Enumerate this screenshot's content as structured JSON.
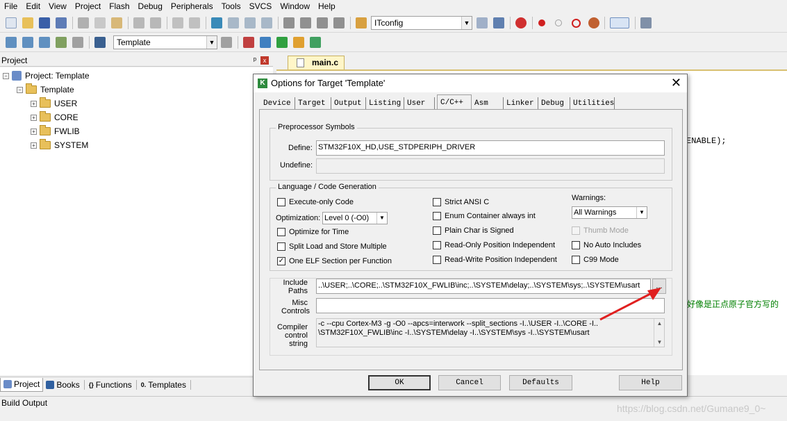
{
  "menu": [
    "File",
    "Edit",
    "View",
    "Project",
    "Flash",
    "Debug",
    "Peripherals",
    "Tools",
    "SVCS",
    "Window",
    "Help"
  ],
  "toolbar": {
    "config_combo": "ITconfig",
    "target_combo": "Template"
  },
  "project_panel": {
    "header": "Project",
    "pin": "ᵖ",
    "close": "x",
    "root": "Project: Template",
    "target": "Template",
    "groups": [
      "USER",
      "CORE",
      "FWLIB",
      "SYSTEM"
    ],
    "tabs": [
      "Project",
      "Books",
      "Functions",
      "Templates"
    ],
    "tab_icons": [
      "",
      "",
      "{}",
      "0."
    ]
  },
  "build_output": "Build Output",
  "editor": {
    "tab": "main.c",
    "fragment_enable": "ENABLE);",
    "fragment_comment": "好像是正点原子官方写的"
  },
  "watermark": "https://blog.csdn.net/Gumane9_0~",
  "dialog": {
    "title": "Options for Target 'Template'",
    "close": "✕",
    "tabs": [
      "Device",
      "Target",
      "Output",
      "Listing",
      "User",
      "C/C++",
      "Asm",
      "Linker",
      "Debug",
      "Utilities"
    ],
    "active_tab": "C/C++",
    "preprocessor": {
      "label": "Preprocessor Symbols",
      "define_label": "Define:",
      "define_value": "STM32F10X_HD,USE_STDPERIPH_DRIVER",
      "undefine_label": "Undefine:",
      "undefine_value": ""
    },
    "language": {
      "label": "Language / Code Generation",
      "execute_only": "Execute-only Code",
      "optimization_label": "Optimization:",
      "optimization_value": "Level 0 (-O0)",
      "optimize_time": "Optimize for Time",
      "split_load": "Split Load and Store Multiple",
      "one_elf": "One ELF Section per Function",
      "strict_ansi": "Strict ANSI C",
      "enum_container": "Enum Container always int",
      "plain_char": "Plain Char is Signed",
      "ro_pi": "Read-Only Position Independent",
      "rw_pi": "Read-Write Position Independent",
      "warnings_label": "Warnings:",
      "warnings_value": "All Warnings",
      "thumb_mode": "Thumb Mode",
      "no_auto_includes": "No Auto Includes",
      "c99_mode": "C99 Mode",
      "check_mark": "✓"
    },
    "include_label_1": "Include",
    "include_label_2": "Paths",
    "include_value": "..\\USER;..\\CORE;..\\STM32F10X_FWLIB\\inc;..\\SYSTEM\\delay;..\\SYSTEM\\sys;..\\SYSTEM\\usart",
    "browse": "...",
    "misc_label_1": "Misc",
    "misc_label_2": "Controls",
    "misc_value": "",
    "compiler_label_1": "Compiler",
    "compiler_label_2": "control",
    "compiler_label_3": "string",
    "compiler_line_1": "-c --cpu Cortex-M3 -g -O0 --apcs=interwork --split_sections -I..\\USER -I..\\CORE -I..",
    "compiler_line_2": "\\STM32F10X_FWLIB\\inc -I..\\SYSTEM\\delay -I..\\SYSTEM\\sys -I..\\SYSTEM\\usart",
    "buttons": {
      "ok": "OK",
      "cancel": "Cancel",
      "defaults": "Defaults",
      "help": "Help"
    }
  },
  "colors": {
    "annotation_arrow": "#e02020",
    "editor_tab": "#fff6c8",
    "comment_green": "#008000"
  }
}
